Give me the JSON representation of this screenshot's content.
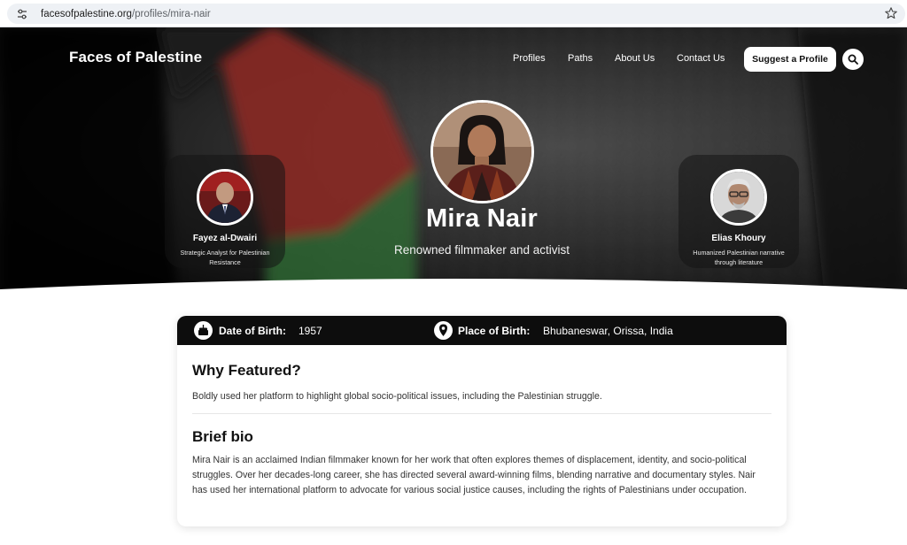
{
  "browser": {
    "url_domain": "facesofpalestine.org",
    "url_path": "/profiles/mira-nair",
    "icons": [
      "tune-icon",
      "star-icon"
    ]
  },
  "nav": {
    "logo": "Faces of Palestine",
    "links": [
      "Profiles",
      "Paths",
      "About Us",
      "Contact Us"
    ],
    "suggest_label": "Suggest a Profile",
    "search_icon": "search-icon"
  },
  "profile": {
    "name": "Mira Nair",
    "tagline": "Renowned filmmaker and activist"
  },
  "adjacent": {
    "prev": {
      "name": "Fayez al-Dwairi",
      "description": "Strategic Analyst for Palestinian Resistance"
    },
    "next": {
      "name": "Elias Khoury",
      "description": "Humanized Palestinian narrative through literature"
    }
  },
  "details": {
    "dob_label": "Date of Birth:",
    "dob_value": "1957",
    "pob_label": "Place of Birth:",
    "pob_value": "Bhubaneswar, Orissa, India",
    "icons": [
      "cake-icon",
      "location-pin-icon"
    ]
  },
  "why_featured": {
    "title": "Why Featured?",
    "text": "Boldly used her platform to highlight global socio-political issues, including the Palestinian struggle."
  },
  "bio": {
    "title": "Brief bio",
    "text": "Mira Nair is an acclaimed Indian filmmaker known for her work that often explores themes of displacement, identity, and socio-political struggles. Over her decades-long career, she has directed several award-winning films, blending narrative and documentary styles. Nair has used her international platform to advocate for various social justice causes, including the rights of Palestinians under occupation."
  },
  "colors": {
    "hero_dark": "#141414",
    "flag_red": "#8a2a22",
    "flag_green": "#2f6a36",
    "info_bar": "#0d0d0d",
    "accent_white": "#ffffff"
  }
}
